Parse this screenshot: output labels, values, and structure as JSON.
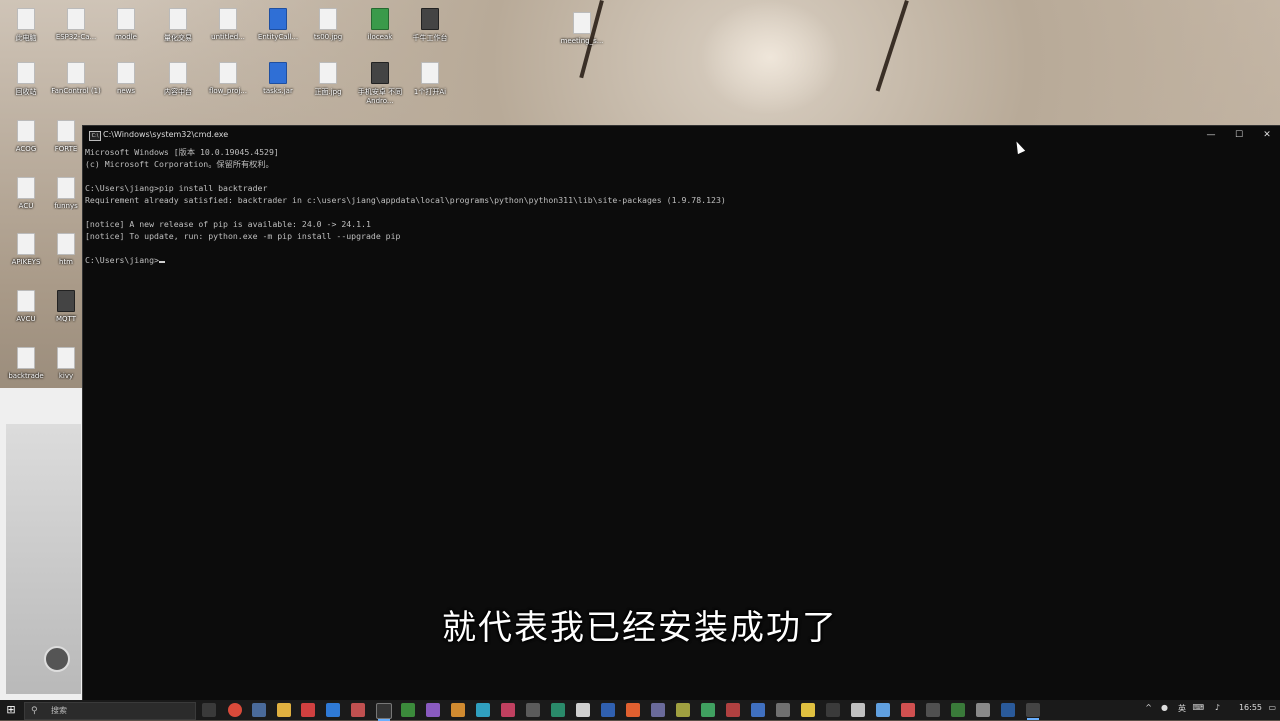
{
  "desktop": {
    "icons": [
      {
        "label": "此电脑"
      },
      {
        "label": "ESP32-Ca..."
      },
      {
        "label": "modle"
      },
      {
        "label": "量化交易"
      },
      {
        "label": "untitled..."
      },
      {
        "label": "EntityCall..."
      },
      {
        "label": "ts00.jpg"
      },
      {
        "label": "iloceak"
      },
      {
        "label": "千牛工作台"
      },
      {
        "label": "meeting_s..."
      },
      {
        "label": "回收站"
      },
      {
        "label": "FanControl (1)"
      },
      {
        "label": "news"
      },
      {
        "label": "内容中台"
      },
      {
        "label": "flow_proj..."
      },
      {
        "label": "tasks.jar"
      },
      {
        "label": "正面.jpg"
      },
      {
        "label": "手机安卓 不同Andro..."
      },
      {
        "label": "1个打开Ai"
      },
      {
        "label": "ACOG"
      },
      {
        "label": "FORTE"
      },
      {
        "label": "ACU"
      },
      {
        "label": "funnys"
      },
      {
        "label": "APIKEYS"
      },
      {
        "label": "htm"
      },
      {
        "label": "AVCU"
      },
      {
        "label": "MQTT"
      },
      {
        "label": "backtrade"
      },
      {
        "label": "kivy"
      }
    ]
  },
  "cmd_window": {
    "title": "C:\\Windows\\system32\\cmd.exe",
    "icon_text": "C:\\",
    "minimize": "—",
    "maximize": "☐",
    "close": "✕",
    "lines": [
      "Microsoft Windows [版本 10.0.19045.4529]",
      "(c) Microsoft Corporation。保留所有权利。",
      "",
      "C:\\Users\\jiang>pip install backtrader",
      "Requirement already satisfied: backtrader in c:\\users\\jiang\\appdata\\local\\programs\\python\\python311\\lib\\site-packages (1.9.78.123)",
      "",
      "[notice] A new release of pip is available: 24.0 -> 24.1.1",
      "[notice] To update, run: python.exe -m pip install --upgrade pip",
      ""
    ],
    "prompt": "C:\\Users\\jiang>"
  },
  "subtitle": "就代表我已经安装成功了",
  "taskbar": {
    "search_placeholder": "搜索",
    "tray_lang": "英",
    "clock": "16:55",
    "accent": "#6ab0ff"
  }
}
